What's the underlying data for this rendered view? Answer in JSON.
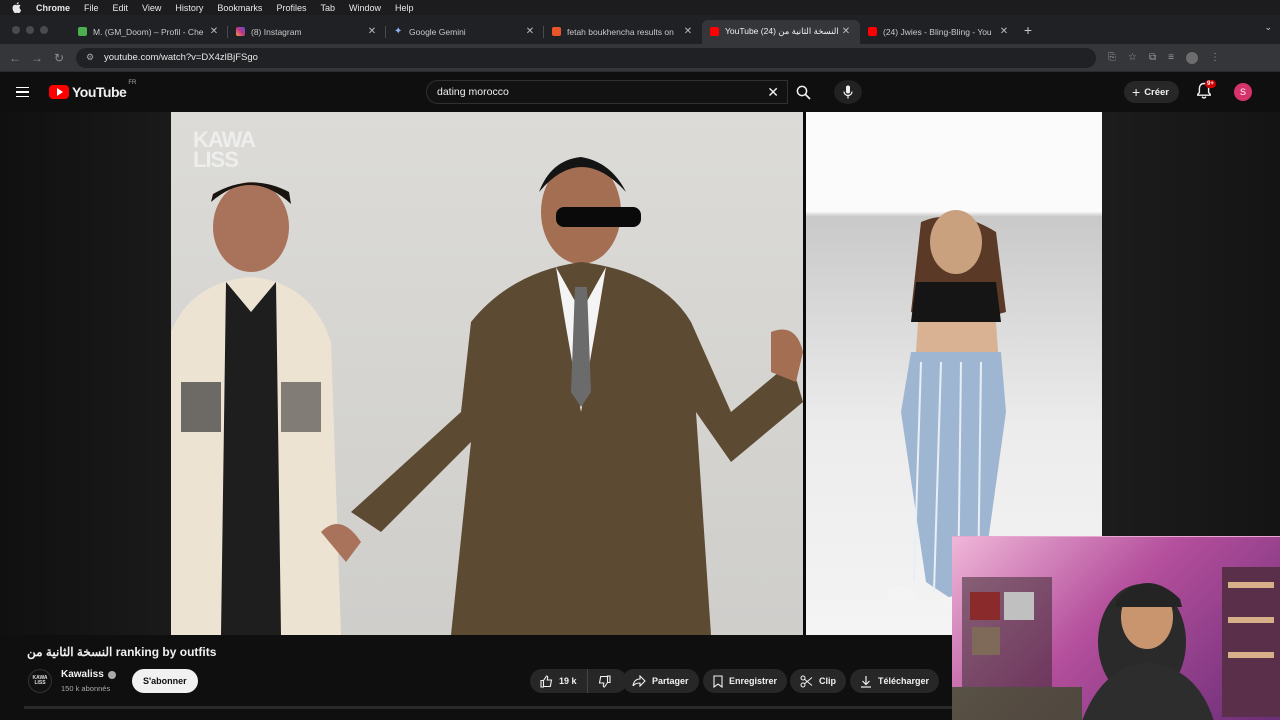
{
  "menubar": {
    "app": "Chrome",
    "items": [
      "File",
      "Edit",
      "View",
      "History",
      "Bookmarks",
      "Profiles",
      "Tab",
      "Window",
      "Help"
    ]
  },
  "tabs": [
    {
      "title": "M. (GM_Doom) – Profil - Che",
      "favicon_color": "#4caf50",
      "active": false
    },
    {
      "title": "(8) Instagram",
      "favicon_color": "#c13584",
      "active": false
    },
    {
      "title": "Google Gemini",
      "favicon_color": "#8ab4f8",
      "active": false
    },
    {
      "title": "fetah boukhencha results on",
      "favicon_color": "#e8552b",
      "active": false
    },
    {
      "title": "YouTube النسخة الثانية من (24)",
      "favicon_color": "#ff0000",
      "active": true
    },
    {
      "title": "(24) Jwies - Bling-Bling - You",
      "favicon_color": "#ff0000",
      "active": false
    }
  ],
  "address": {
    "url": "youtube.com/watch?v=DX4zlBjFSgo"
  },
  "youtube": {
    "logo_text": "YouTube",
    "country": "FR",
    "search_value": "dating morocco",
    "create_label": "Créer",
    "notif_badge": "9+",
    "user_initial": "S"
  },
  "video": {
    "watermark_line1": "KAWA",
    "watermark_line2": "LISS"
  },
  "info": {
    "title": "النسخة الثانية من ranking by outfits",
    "channel": "Kawaliss",
    "channel_avatar_text": "KAWA LISS",
    "subscribers": "150 k abonnés",
    "subscribe_label": "S'abonner",
    "likes": "19 k",
    "share_label": "Partager",
    "save_label": "Enregistrer",
    "clip_label": "Clip",
    "download_label": "Télécharger"
  },
  "colors": {
    "accent": "#ff0000",
    "background": "#0f0f0f",
    "avatar": "#d6336c"
  }
}
